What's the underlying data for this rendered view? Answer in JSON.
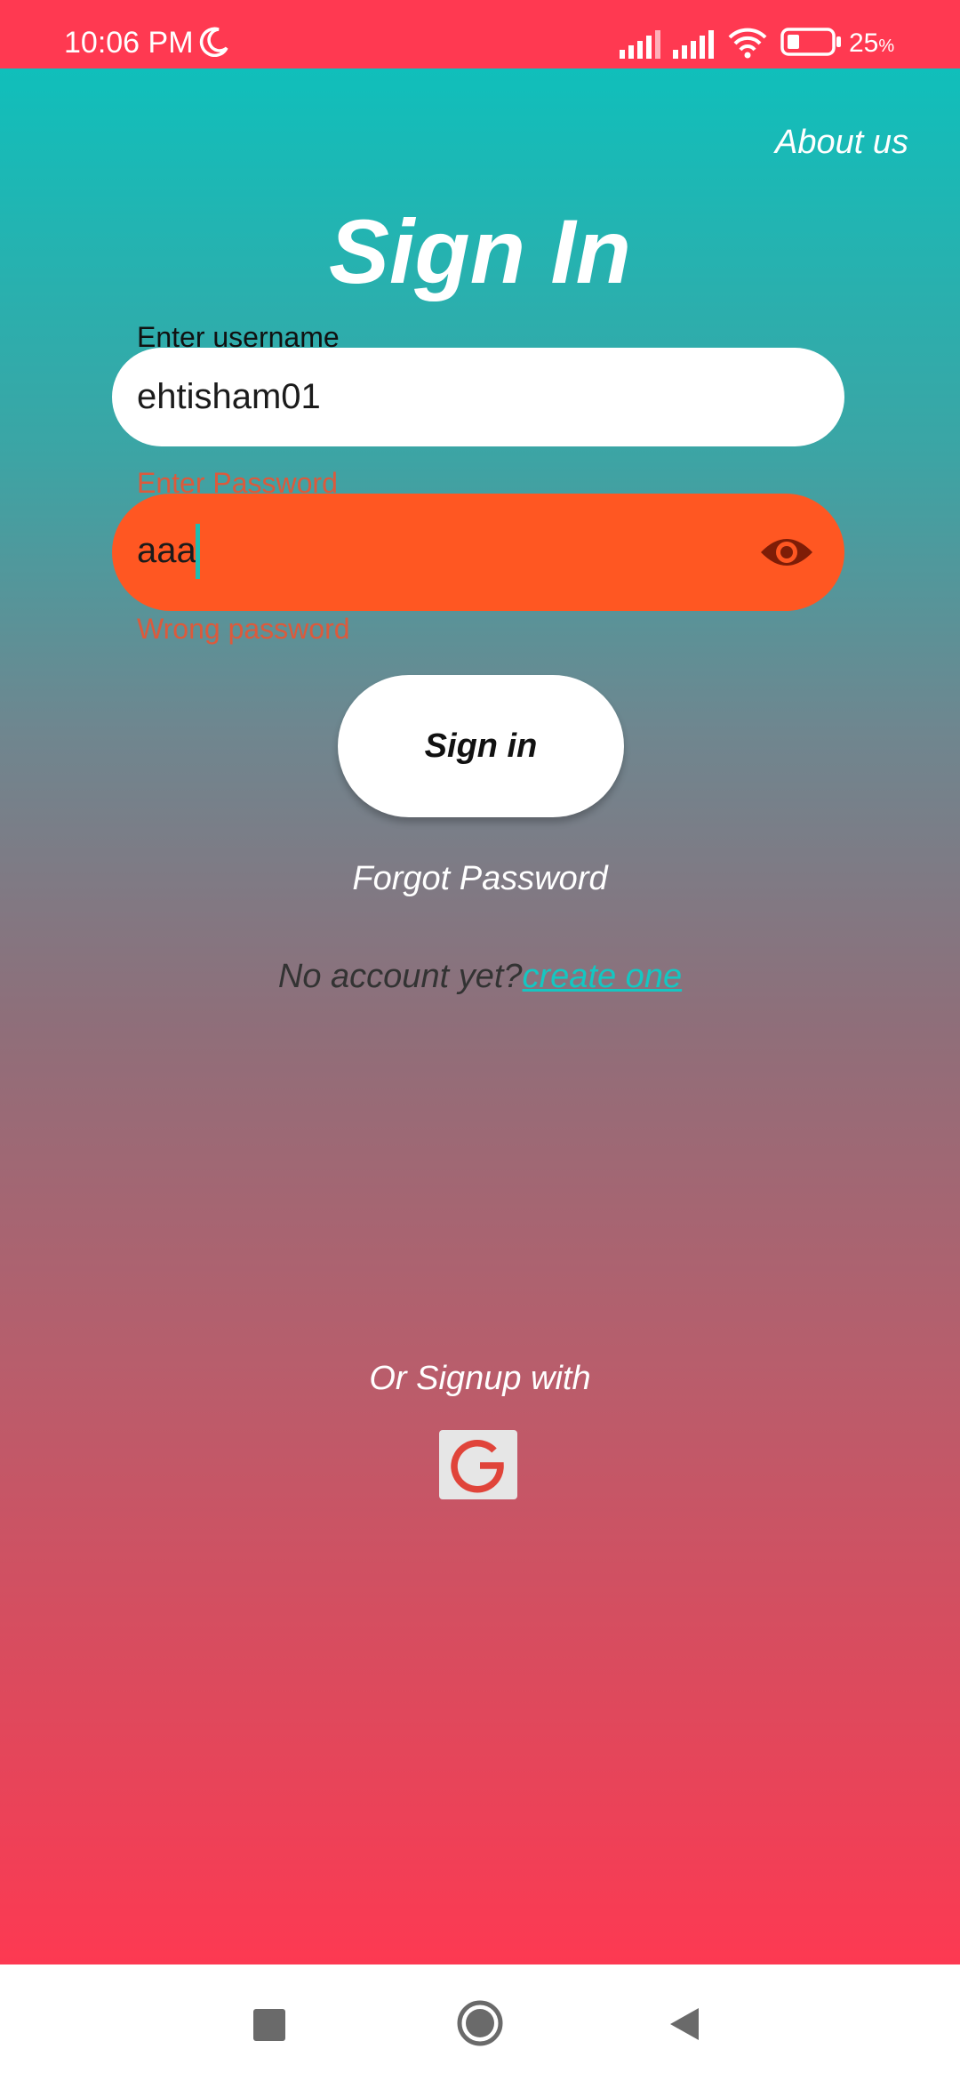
{
  "status_bar": {
    "time": "10:06 PM",
    "battery_percent": "25",
    "battery_unit": "%",
    "icons": [
      "moon-icon",
      "signal-icon",
      "signal-icon",
      "wifi-icon",
      "battery-icon"
    ]
  },
  "header": {
    "about_label": "About us",
    "title": "Sign In"
  },
  "form": {
    "username_label": "Enter username",
    "username_value": "ehtisham01",
    "password_label": "Enter Password",
    "password_value": "aaa",
    "password_error": "Wrong password",
    "password_toggle_icon": "eye-icon",
    "signin_label": "Sign in"
  },
  "links": {
    "forgot_password": "Forgot Password",
    "no_account_text": "No account yet?",
    "create_account": "create one"
  },
  "social": {
    "or_signup": "Or Signup with",
    "google_icon": "google-icon"
  },
  "nav_bar": {
    "buttons": [
      "recents-icon",
      "home-icon",
      "back-icon"
    ]
  },
  "colors": {
    "status_bar": "#ff3951",
    "gradient_top": "#10bfbb",
    "gradient_bottom": "#fd3952",
    "error_field": "#ff5722",
    "error_text": "#dc5a3c",
    "link": "#14c7c2"
  }
}
